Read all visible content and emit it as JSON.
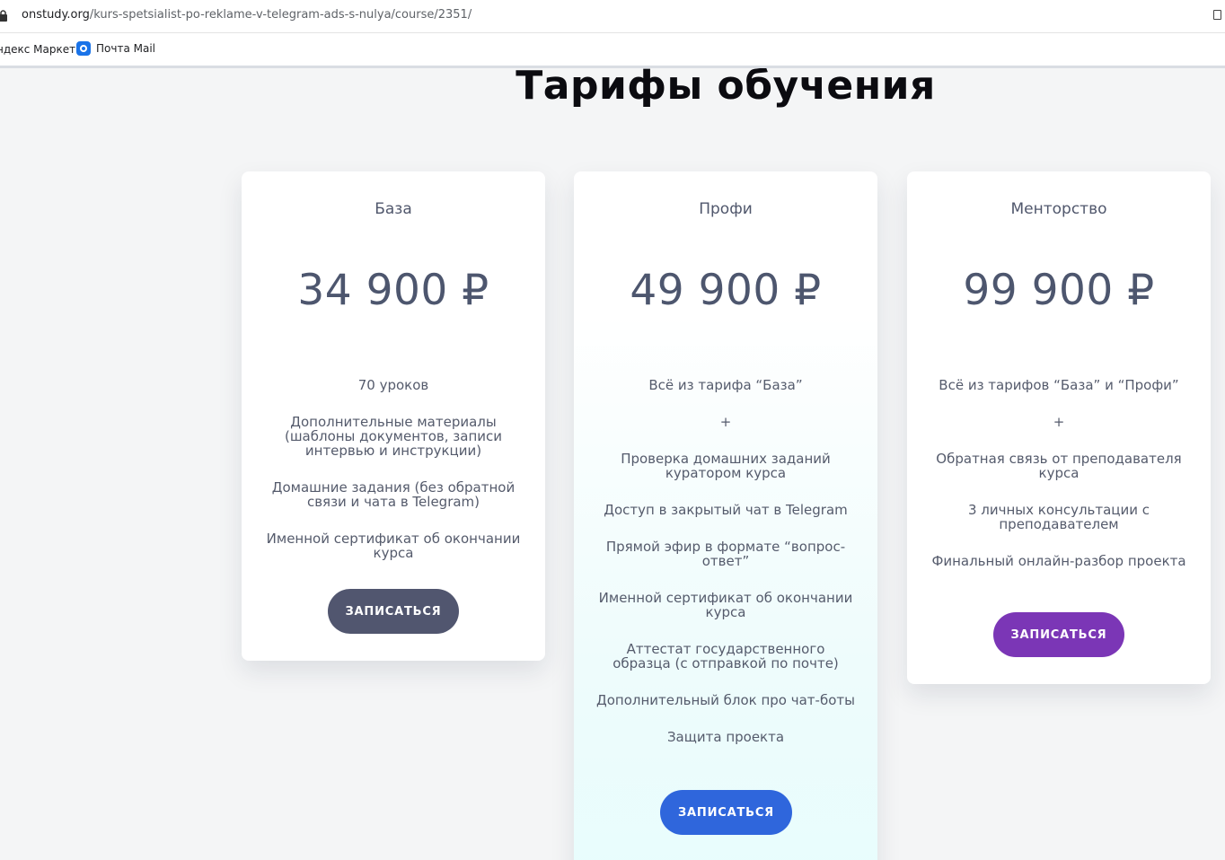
{
  "browser": {
    "url_domain": "onstudy.org",
    "url_path": "/kurs-spetsialist-po-reklame-v-telegram-ads-s-nulya/course/2351/",
    "bookmarks": [
      {
        "label": "ндекс Маркет"
      },
      {
        "label": "Почта Mail"
      }
    ]
  },
  "page": {
    "title": "Тарифы обучения"
  },
  "plans": [
    {
      "name": "База",
      "price": "34 900 ₽",
      "features": [
        "70 уроков",
        "Дополнительные материалы (шаблоны документов, записи интервью и инструкции)",
        "Домашние задания (без обратной связи и чата в Telegram)",
        "Именной сертификат об окончании курса"
      ],
      "button_label": "ЗАПИСАТЬСЯ",
      "button_color": "#51566f"
    },
    {
      "name": "Профи",
      "price": "49 900 ₽",
      "features": [
        "Всё из тарифа “База”",
        "+",
        "Проверка домашних заданий куратором курса",
        "Доступ в закрытый чат в Telegram",
        "Прямой эфир в формате “вопрос-ответ”",
        "Именной сертификат об окончании курса",
        "Аттестат государственного образца (с отправкой по почте)",
        "Дополнительный блок про чат-боты",
        "Защита проекта"
      ],
      "button_label": "ЗАПИСАТЬСЯ",
      "button_color": "#2f66dc"
    },
    {
      "name": "Менторство",
      "price": "99 900 ₽",
      "features": [
        "Всё из тарифов “База” и “Профи”",
        "+",
        "Обратная связь от преподавателя курса",
        "3 личных консультации с преподавателем",
        "Финальный онлайн-разбор проекта"
      ],
      "button_label": "ЗАПИСАТЬСЯ",
      "button_color": "#7b36b6"
    }
  ]
}
